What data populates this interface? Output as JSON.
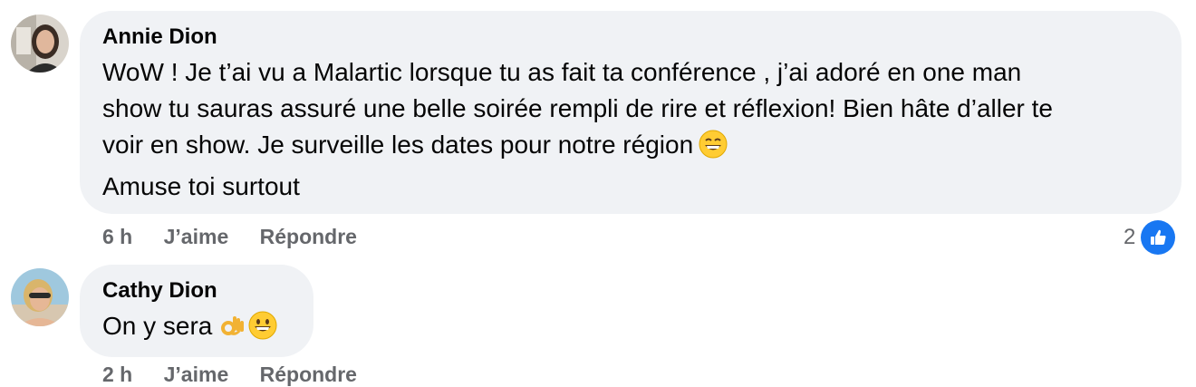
{
  "comments": [
    {
      "author": "Annie Dion",
      "lines": [
        "WoW ! Je t’ai vu a Malartic lorsque tu as fait ta conférence , j’ai adoré en one man",
        "show tu sauras assuré une belle soirée rempli de rire et réflexion! Bien hâte d’aller te",
        "voir en show. Je surveille les dates pour notre région",
        "Amuse toi surtout"
      ],
      "emoji": [
        "grinning-face-with-smiling-eyes"
      ],
      "time": "6 h",
      "like_label": "J’aime",
      "reply_label": "Répondre",
      "reaction_count": "2",
      "reaction_icon": "thumbs-up-icon"
    },
    {
      "author": "Cathy Dion",
      "text": "On y sera",
      "emoji": [
        "ok-hand",
        "grinning-face"
      ],
      "time": "2 h",
      "like_label": "J’aime",
      "reply_label": "Répondre"
    }
  ],
  "colors": {
    "bubble": "#f0f2f5",
    "meta": "#65676b",
    "like_blue": "#1877f2"
  }
}
